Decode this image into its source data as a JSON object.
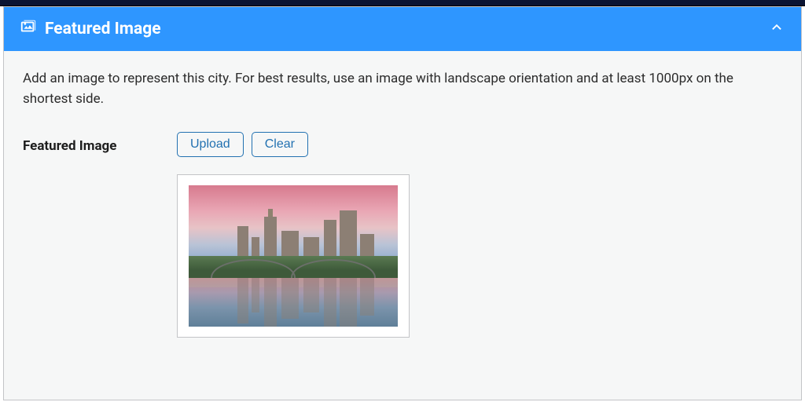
{
  "panel": {
    "title": "Featured Image",
    "description": "Add an image to represent this city. For best results, use an image with landscape orientation and at least 1000px on the shortest side.",
    "collapsed": false
  },
  "field": {
    "label": "Featured Image",
    "buttons": {
      "upload": "Upload",
      "clear": "Clear"
    }
  }
}
